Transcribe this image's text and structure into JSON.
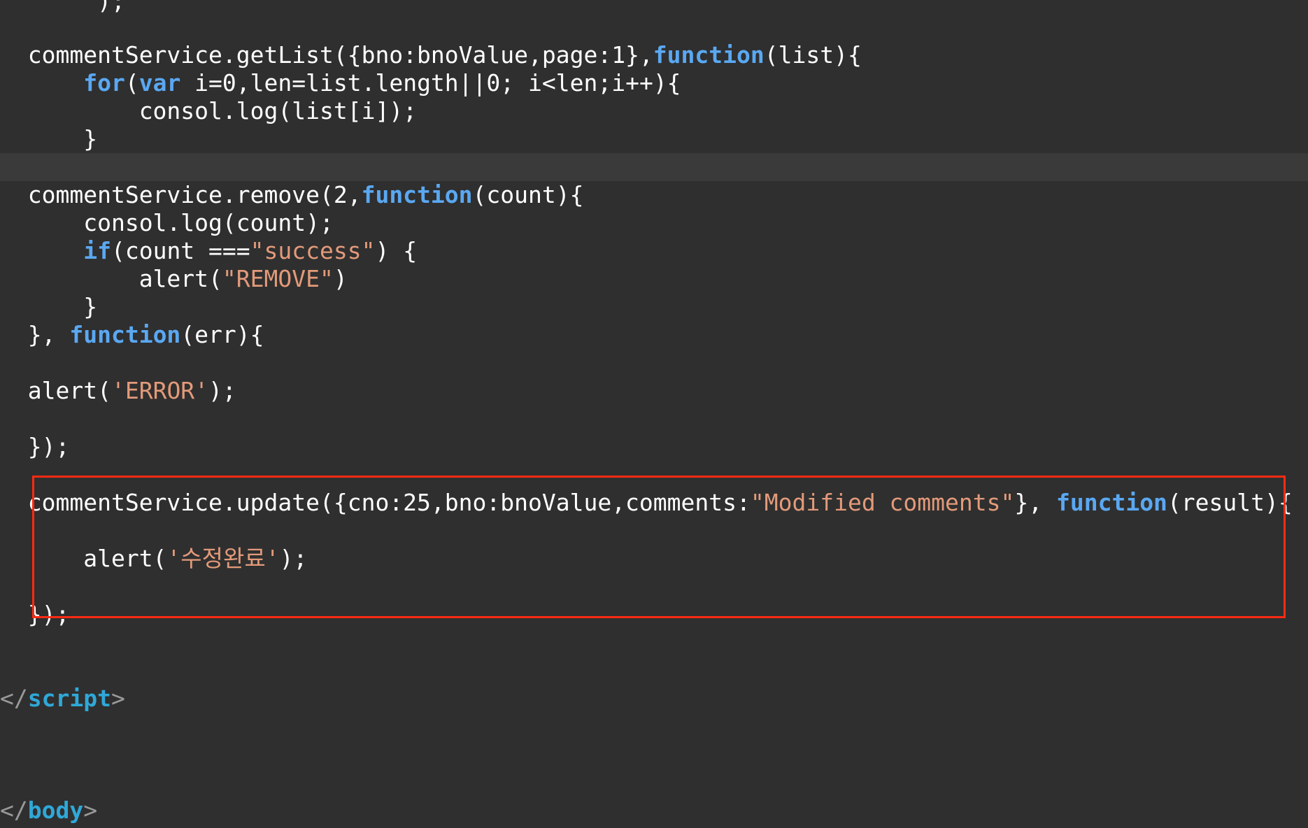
{
  "editor": {
    "lines": [
      {
        "id": "partial-close",
        "indent": "       ",
        "segments": [
          {
            "t": "p",
            "v": ");"
          }
        ]
      },
      {
        "id": "getlist-call",
        "indent": "  ",
        "segments": [
          {
            "t": "p",
            "v": "commentService.getList({bno:bnoValue,page:1},"
          },
          {
            "t": "k",
            "v": "function"
          },
          {
            "t": "p",
            "v": "(list){"
          }
        ]
      },
      {
        "id": "for-loop",
        "indent": "      ",
        "segments": [
          {
            "t": "k",
            "v": "for"
          },
          {
            "t": "p",
            "v": "("
          },
          {
            "t": "k",
            "v": "var"
          },
          {
            "t": "p",
            "v": " i=0,len=list.length||0; i<len;i++){"
          }
        ]
      },
      {
        "id": "consol-log-list",
        "indent": "          ",
        "segments": [
          {
            "t": "p",
            "v": "consol.log(list[i]);"
          }
        ]
      },
      {
        "id": "for-close",
        "indent": "      ",
        "segments": [
          {
            "t": "p",
            "v": "}"
          }
        ]
      },
      {
        "id": "remove-call",
        "indent": "  ",
        "segments": [
          {
            "t": "p",
            "v": "commentService.remove(2,"
          },
          {
            "t": "k",
            "v": "function"
          },
          {
            "t": "p",
            "v": "(count){"
          }
        ]
      },
      {
        "id": "consol-log-count",
        "indent": "      ",
        "segments": [
          {
            "t": "p",
            "v": "consol.log(count);"
          }
        ]
      },
      {
        "id": "if-success",
        "indent": "      ",
        "segments": [
          {
            "t": "k",
            "v": "if"
          },
          {
            "t": "p",
            "v": "(count ==="
          },
          {
            "t": "s",
            "v": "\"success\""
          },
          {
            "t": "p",
            "v": ") {"
          }
        ]
      },
      {
        "id": "alert-remove",
        "indent": "          ",
        "segments": [
          {
            "t": "p",
            "v": "alert("
          },
          {
            "t": "s",
            "v": "\"REMOVE\""
          },
          {
            "t": "p",
            "v": ")"
          }
        ]
      },
      {
        "id": "if-close",
        "indent": "      ",
        "segments": [
          {
            "t": "p",
            "v": "}"
          }
        ]
      },
      {
        "id": "error-callback",
        "indent": "  ",
        "segments": [
          {
            "t": "p",
            "v": "}, "
          },
          {
            "t": "k",
            "v": "function"
          },
          {
            "t": "p",
            "v": "(err){"
          }
        ]
      },
      {
        "id": "alert-error",
        "indent": "  ",
        "segments": [
          {
            "t": "p",
            "v": "alert("
          },
          {
            "t": "s",
            "v": "'ERROR'"
          },
          {
            "t": "p",
            "v": ");"
          }
        ]
      },
      {
        "id": "remove-close",
        "indent": "  ",
        "segments": [
          {
            "t": "p",
            "v": "});"
          }
        ]
      },
      {
        "id": "update-call",
        "indent": "  ",
        "segments": [
          {
            "t": "p",
            "v": "commentService.update({cno:25,bno:bnoValue,comments:"
          },
          {
            "t": "s",
            "v": "\"Modified comments\""
          },
          {
            "t": "p",
            "v": "}, "
          },
          {
            "t": "k",
            "v": "function"
          },
          {
            "t": "p",
            "v": "(result){"
          }
        ]
      },
      {
        "id": "alert-modified",
        "indent": "      ",
        "segments": [
          {
            "t": "p",
            "v": "alert("
          },
          {
            "t": "s",
            "v": "'수정완료'"
          },
          {
            "t": "p",
            "v": ");"
          }
        ]
      },
      {
        "id": "update-close",
        "indent": "  ",
        "segments": [
          {
            "t": "p",
            "v": "});"
          }
        ]
      },
      {
        "id": "script-close",
        "indent": "",
        "segments": [
          {
            "t": "b",
            "v": "</"
          },
          {
            "t": "g",
            "v": "script"
          },
          {
            "t": "b",
            "v": ">"
          }
        ]
      },
      {
        "id": "body-close",
        "indent": "",
        "segments": [
          {
            "t": "b",
            "v": "</"
          },
          {
            "t": "g",
            "v": "body"
          },
          {
            "t": "b",
            "v": ">"
          }
        ]
      }
    ]
  },
  "colors": {
    "background": "#2f2f2f",
    "current_line": "#3a3a3a",
    "plain": "#ffffff",
    "keyword": "#5aa8f2",
    "string": "#e39a7a",
    "tag": "#2fa8d8",
    "highlight_border": "#ff2a12"
  }
}
